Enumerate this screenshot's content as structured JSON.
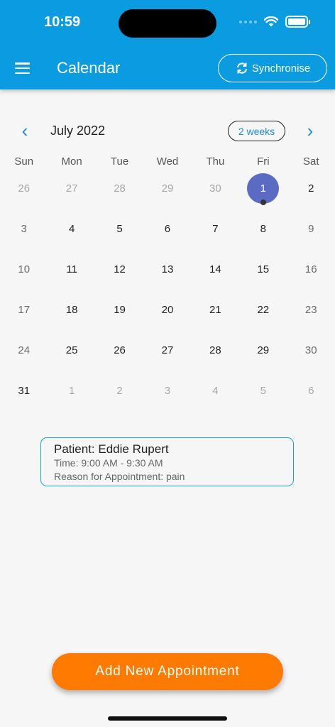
{
  "status_bar": {
    "time": "10:59"
  },
  "header": {
    "title": "Calendar",
    "sync_label": "Synchronise"
  },
  "calendar": {
    "month_label": "July 2022",
    "view_toggle": "2 weeks",
    "prev_arrow": "‹",
    "next_arrow": "›",
    "weekdays": [
      "Sun",
      "Mon",
      "Tue",
      "Wed",
      "Thu",
      "Fri",
      "Sat"
    ],
    "selected_day": "1",
    "weeks": [
      [
        "26",
        "27",
        "28",
        "29",
        "30",
        "1",
        "2"
      ],
      [
        "3",
        "4",
        "5",
        "6",
        "7",
        "8",
        "9"
      ],
      [
        "10",
        "11",
        "12",
        "13",
        "14",
        "15",
        "16"
      ],
      [
        "17",
        "18",
        "19",
        "20",
        "21",
        "22",
        "23"
      ],
      [
        "24",
        "25",
        "26",
        "27",
        "28",
        "29",
        "30"
      ],
      [
        "31",
        "1",
        "2",
        "3",
        "4",
        "5",
        "6"
      ]
    ]
  },
  "appointment": {
    "patient": "Patient: Eddie Rupert",
    "time": "Time: 9:00 AM - 9:30 AM",
    "reason": "Reason for Appointment: pain"
  },
  "actions": {
    "add_appointment": "Add New Appointment"
  },
  "colors": {
    "header": "#0b9be0",
    "accent": "#1e88e5",
    "selected_day": "#5b6bc4",
    "add_button": "#ff7a00",
    "card_border": "#1a9fd8"
  },
  "icons": {
    "menu": "hamburger-menu-icon",
    "sync": "sync-icon",
    "prev": "chevron-left-icon",
    "next": "chevron-right-icon"
  }
}
